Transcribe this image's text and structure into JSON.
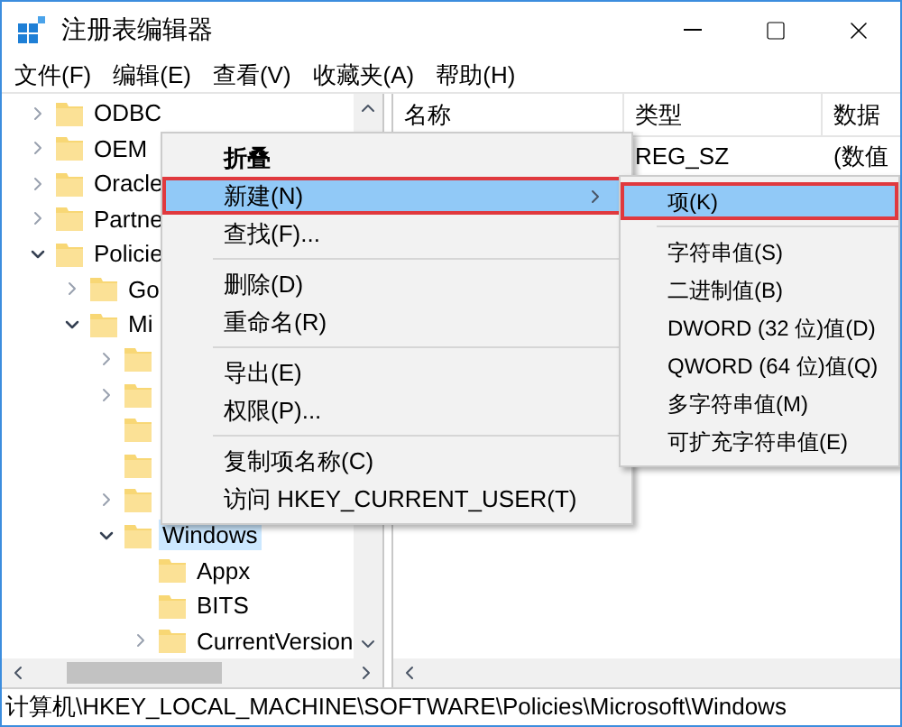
{
  "window": {
    "title": "注册表编辑器"
  },
  "menu_bar": [
    "文件(F)",
    "编辑(E)",
    "查看(V)",
    "收藏夹(A)",
    "帮助(H)"
  ],
  "tree": [
    {
      "label": "ODBC",
      "kind": "branch",
      "expanded": false,
      "selected": false
    },
    {
      "label": "OEM",
      "kind": "branch",
      "expanded": false,
      "selected": false
    },
    {
      "label": "Oracle",
      "kind": "branch",
      "expanded": false,
      "selected": false
    },
    {
      "label": "Partne",
      "kind": "branch",
      "expanded": false,
      "selected": false
    },
    {
      "label": "Policie",
      "kind": "branch",
      "expanded": true,
      "selected": false,
      "children": [
        {
          "label": "Go",
          "kind": "branch",
          "expanded": false,
          "selected": false
        },
        {
          "label": "Mi",
          "kind": "branch",
          "expanded": true,
          "selected": false,
          "children": [
            {
              "kind": "branch",
              "expanded": false
            },
            {
              "kind": "branch",
              "expanded": false
            },
            {
              "kind": "leaf"
            },
            {
              "kind": "leaf"
            },
            {
              "kind": "branch",
              "expanded": false
            },
            {
              "label": "Windows",
              "kind": "branch",
              "expanded": true,
              "selected": true,
              "children": [
                {
                  "label": "Appx",
                  "kind": "leaf",
                  "selected": false
                },
                {
                  "label": "BITS",
                  "kind": "leaf",
                  "selected": false
                },
                {
                  "label": "CurrentVersion",
                  "kind": "branch",
                  "expanded": false,
                  "selected": false
                }
              ]
            }
          ]
        }
      ]
    }
  ],
  "table": {
    "columns": [
      "名称",
      "类型",
      "数据"
    ],
    "rows": [
      {
        "type": "REG_SZ",
        "data": "(数值"
      }
    ]
  },
  "context_menu": [
    {
      "label": "折叠",
      "kind": "item",
      "bold": true,
      "selected": false,
      "outlined": false,
      "submenu": false
    },
    {
      "label": "新建(N)",
      "kind": "item",
      "bold": false,
      "selected": true,
      "outlined": true,
      "submenu": true
    },
    {
      "label": "查找(F)...",
      "kind": "item",
      "bold": false,
      "selected": false,
      "outlined": false,
      "submenu": false
    },
    {
      "kind": "separator"
    },
    {
      "label": "删除(D)",
      "kind": "item",
      "bold": false,
      "selected": false,
      "outlined": false,
      "submenu": false
    },
    {
      "label": "重命名(R)",
      "kind": "item",
      "bold": false,
      "selected": false,
      "outlined": false,
      "submenu": false
    },
    {
      "kind": "separator"
    },
    {
      "label": "导出(E)",
      "kind": "item",
      "bold": false,
      "selected": false,
      "outlined": false,
      "submenu": false
    },
    {
      "label": "权限(P)...",
      "kind": "item",
      "bold": false,
      "selected": false,
      "outlined": false,
      "submenu": false
    },
    {
      "kind": "separator"
    },
    {
      "label": "复制项名称(C)",
      "kind": "item",
      "bold": false,
      "selected": false,
      "outlined": false,
      "submenu": false
    },
    {
      "label": "访问 HKEY_CURRENT_USER(T)",
      "kind": "item",
      "bold": false,
      "selected": false,
      "outlined": false,
      "submenu": false
    }
  ],
  "submenu": [
    {
      "label": "项(K)",
      "kind": "item",
      "selected": true,
      "outlined": true
    },
    {
      "kind": "separator"
    },
    {
      "label": "字符串值(S)",
      "kind": "item",
      "selected": false,
      "outlined": false
    },
    {
      "label": "二进制值(B)",
      "kind": "item",
      "selected": false,
      "outlined": false
    },
    {
      "label": "DWORD (32 位)值(D)",
      "kind": "item",
      "selected": false,
      "outlined": false
    },
    {
      "label": "QWORD (64 位)值(Q)",
      "kind": "item",
      "selected": false,
      "outlined": false
    },
    {
      "label": "多字符串值(M)",
      "kind": "item",
      "selected": false,
      "outlined": false
    },
    {
      "label": "可扩充字符串值(E)",
      "kind": "item",
      "selected": false,
      "outlined": false
    }
  ],
  "status_bar": "计算机\\HKEY_LOCAL_MACHINE\\SOFTWARE\\Policies\\Microsoft\\Windows"
}
